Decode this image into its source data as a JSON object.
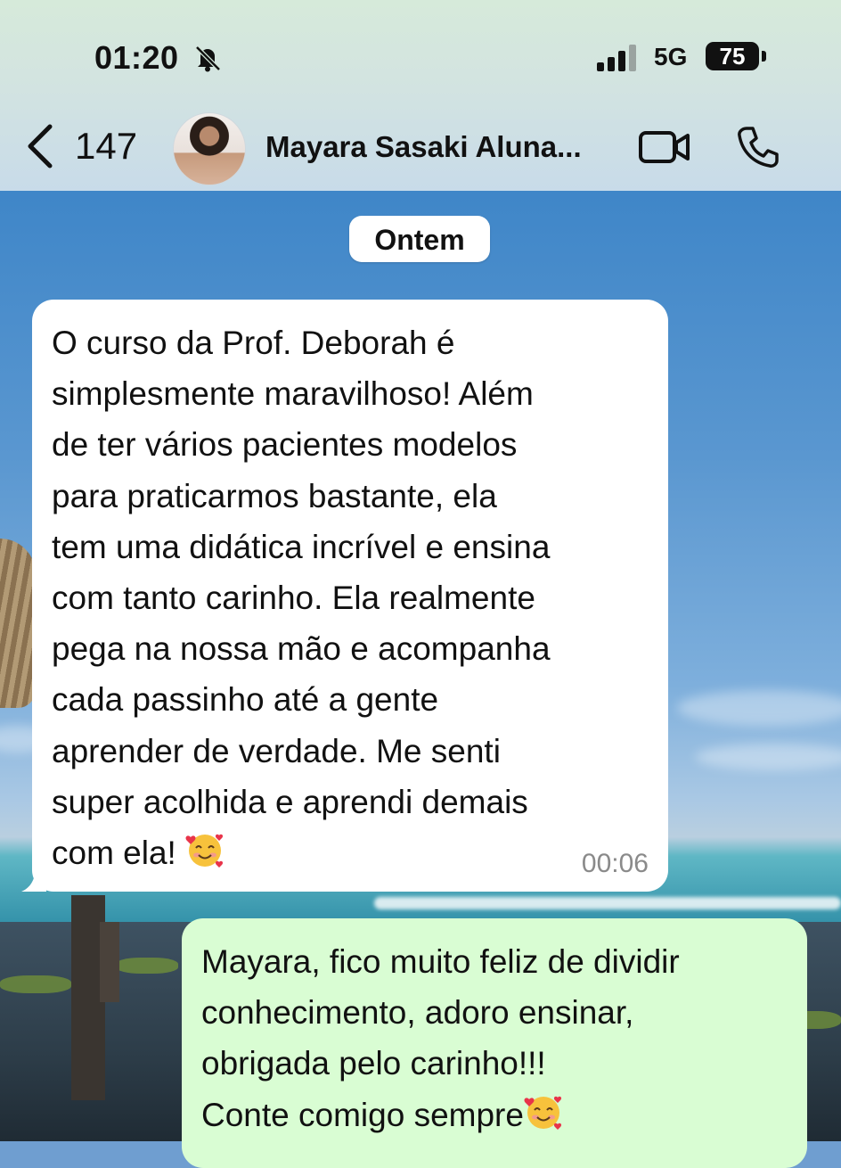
{
  "status_bar": {
    "time": "01:20",
    "network": "5G",
    "battery": "75",
    "icons": [
      "bell-slash-icon",
      "signal-icon"
    ]
  },
  "chat_header": {
    "back_count": "147",
    "contact_name": "Mayara Sasaki Aluna...",
    "icons": [
      "chevron-left-icon",
      "avatar",
      "video-camera-icon",
      "phone-icon"
    ]
  },
  "chat": {
    "date_chip": "Ontem",
    "incoming": {
      "text": "O curso da Prof. Deborah é\nsimplesmente maravilhoso! Além\nde ter vários pacientes modelos\npara praticarmos bastante, ela\ntem uma didática incrível e ensina\ncom tanto carinho. Ela realmente\npega na nossa mão e acompanha\ncada passinho até a gente\naprender de verdade. Me senti\nsuper acolhida e aprendi demais\ncom ela! ",
      "emoji": "smiling-face-with-hearts-icon",
      "time": "00:06"
    },
    "outgoing": {
      "text": "Mayara, fico muito feliz de dividir\nconhecimento, adoro ensinar,\nobrigada pelo carinho!!!\nConte comigo sempre",
      "emoji": "smiling-face-with-hearts-icon"
    }
  },
  "colors": {
    "incoming_bubble": "#ffffff",
    "outgoing_bubble": "#d9fdd3",
    "header_bg": "#d3e4e0",
    "timestamp": "#8a8a8a"
  }
}
